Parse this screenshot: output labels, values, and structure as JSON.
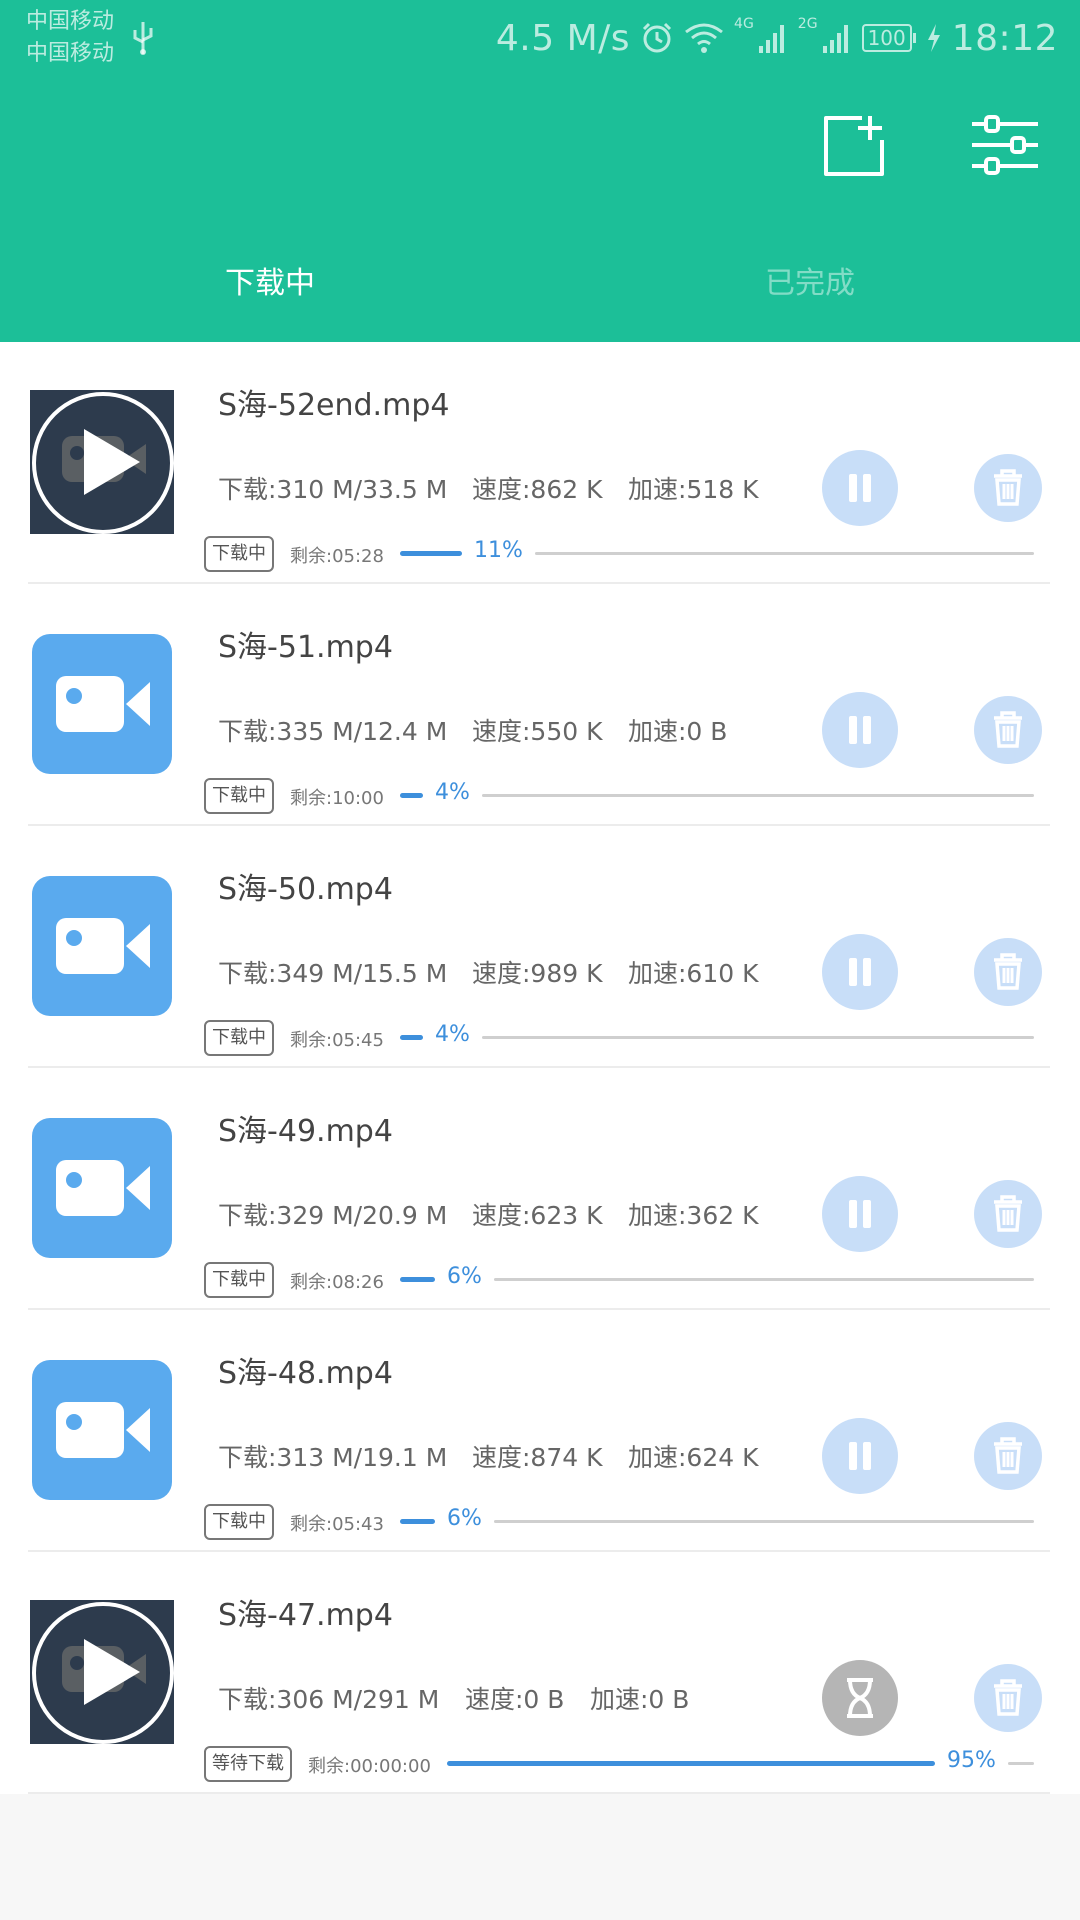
{
  "status_bar": {
    "carrier1": "中国移动",
    "carrier2": "中国移动",
    "net_speed": "4.5 M/s",
    "net_tag_1": "4G",
    "net_tag_2": "2G",
    "battery": "100",
    "time": "18:12",
    "icons": [
      "usb-icon",
      "alarm-icon",
      "wifi-icon",
      "signal-icon",
      "charging-icon"
    ]
  },
  "toolbar": {
    "icons": [
      "add-task-icon",
      "settings-sliders-icon"
    ]
  },
  "tabs": [
    {
      "label": "下载中",
      "active": true
    },
    {
      "label": "已完成",
      "active": false
    }
  ],
  "downloads": [
    {
      "name": "S海-52end.mp4",
      "downloaded": "下载:310 M/33.5 M",
      "speed": "速度:862 K",
      "boost": "加速:518 K",
      "status": "下载中",
      "remaining": "剩余:05:28",
      "percent": "11%",
      "progress": 0.11,
      "thumb": "video-thumbnail",
      "action": "pause"
    },
    {
      "name": "S海-51.mp4",
      "downloaded": "下载:335 M/12.4 M",
      "speed": "速度:550 K",
      "boost": "加速:0 B",
      "status": "下载中",
      "remaining": "剩余:10:00",
      "percent": "4%",
      "progress": 0.04,
      "thumb": "video-file-icon",
      "action": "pause"
    },
    {
      "name": "S海-50.mp4",
      "downloaded": "下载:349 M/15.5 M",
      "speed": "速度:989 K",
      "boost": "加速:610 K",
      "status": "下载中",
      "remaining": "剩余:05:45",
      "percent": "4%",
      "progress": 0.04,
      "thumb": "video-file-icon",
      "action": "pause"
    },
    {
      "name": "S海-49.mp4",
      "downloaded": "下载:329 M/20.9 M",
      "speed": "速度:623 K",
      "boost": "加速:362 K",
      "status": "下载中",
      "remaining": "剩余:08:26",
      "percent": "6%",
      "progress": 0.06,
      "thumb": "video-file-icon",
      "action": "pause"
    },
    {
      "name": "S海-48.mp4",
      "downloaded": "下载:313 M/19.1 M",
      "speed": "速度:874 K",
      "boost": "加速:624 K",
      "status": "下载中",
      "remaining": "剩余:05:43",
      "percent": "6%",
      "progress": 0.06,
      "thumb": "video-file-icon",
      "action": "pause"
    },
    {
      "name": "S海-47.mp4",
      "downloaded": "下载:306 M/291 M",
      "speed": "速度:0 B",
      "boost": "加速:0 B",
      "status": "等待下载",
      "remaining": "剩余:00:00:00",
      "percent": "95%",
      "progress": 0.95,
      "thumb": "video-thumbnail",
      "action": "waiting"
    }
  ],
  "colors": {
    "header": "#1cbf98",
    "progress": "#3d8fdc",
    "button_bg": "#c8def8",
    "file_icon": "#5aaaee"
  }
}
